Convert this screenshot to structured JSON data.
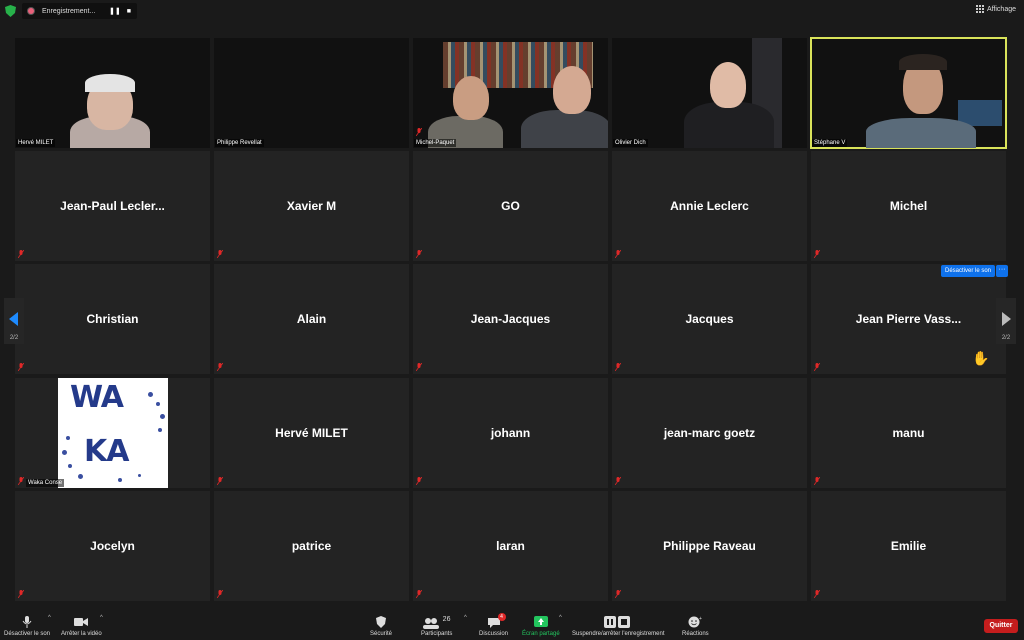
{
  "topbar": {
    "recording_label": "Enregistrement...",
    "pause_glyph": "❚❚",
    "stop_glyph": "■",
    "view_label": "Affichage"
  },
  "video_tiles": [
    {
      "name": "Hervé MILET"
    },
    {
      "name": "Philippe Revellat"
    },
    {
      "name": "Michel-Paquet"
    },
    {
      "name": "Olivier Dich"
    },
    {
      "name": "Stéphane V"
    }
  ],
  "name_tiles": [
    "Jean-Paul  Lecler...",
    "Xavier M",
    "GO",
    "Annie Leclerc",
    "Michel",
    "Christian",
    "Alain",
    "Jean-Jacques",
    "Jacques",
    "Jean  Pierre  Vass...",
    "",
    "Hervé MILET",
    "johann",
    "jean-marc goetz",
    "manu",
    "Jocelyn",
    "patrice",
    "laran",
    "Philippe Raveau",
    "Emilie"
  ],
  "logo_tile": {
    "name": "Waka Conseil",
    "label": "Waka Conse",
    "logo_top": "WA",
    "logo_bottom": "KA"
  },
  "pager": {
    "left": "2/2",
    "right": "2/2"
  },
  "hover": {
    "unmute_label": "Désactiver le son",
    "more_label": "···"
  },
  "toolbar": {
    "mute_label": "Désactiver le son",
    "video_label": "Arrêter la vidéo",
    "security_label": "Sécurité",
    "participants_label": "Participants",
    "participants_count": "26",
    "chat_label": "Discussion",
    "chat_badge": "4",
    "share_label": "Écran partagé",
    "record_label": "Suspendre/arrêter l'enregistrement",
    "reactions_label": "Réactions",
    "quit_label": "Quitter"
  },
  "colors": {
    "accent": "#0e71eb",
    "active_speaker": "#d9e35a",
    "quit": "#c51d1d",
    "share_green": "#23c55e",
    "muted_red": "#e02828"
  }
}
